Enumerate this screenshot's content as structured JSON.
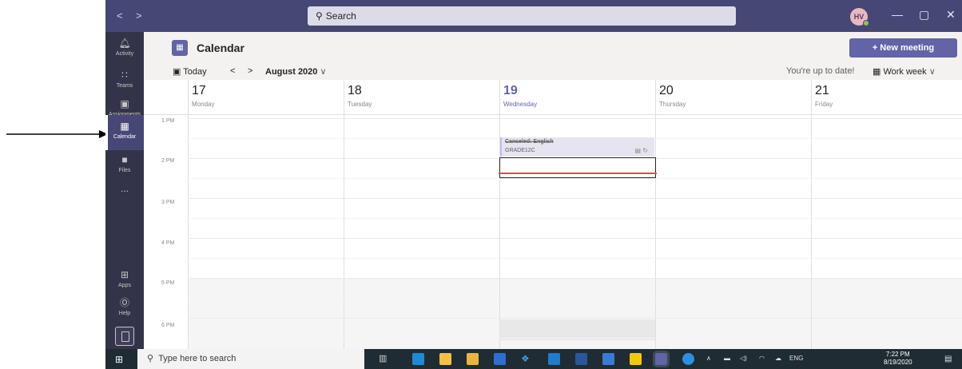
{
  "window": {
    "nav_back": "<",
    "nav_forward": ">",
    "search_placeholder": "Search",
    "avatar_initials": "HV",
    "minimize": "—",
    "maximize": "▢",
    "close": "✕"
  },
  "rail": {
    "items": [
      {
        "label": "Activity",
        "icon": "bell-icon"
      },
      {
        "label": "Teams",
        "icon": "teams-icon"
      },
      {
        "label": "Assignments",
        "icon": "assignments-icon"
      },
      {
        "label": "Calendar",
        "icon": "calendar-icon"
      },
      {
        "label": "Files",
        "icon": "files-icon"
      },
      {
        "label": "...",
        "icon": "more-icon"
      },
      {
        "label": "Apps",
        "icon": "apps-icon"
      },
      {
        "label": "Help",
        "icon": "help-icon"
      }
    ]
  },
  "header": {
    "title": "Calendar",
    "new_meeting": "+ New meeting"
  },
  "toolbar": {
    "today": "Today",
    "prev": "<",
    "next": ">",
    "month": "August 2020",
    "status": "You're up to date!",
    "view": "Work week"
  },
  "days": [
    {
      "num": "17",
      "name": "Monday"
    },
    {
      "num": "18",
      "name": "Tuesday"
    },
    {
      "num": "19",
      "name": "Wednesday"
    },
    {
      "num": "20",
      "name": "Thursday"
    },
    {
      "num": "21",
      "name": "Friday"
    }
  ],
  "hours": [
    "1 PM",
    "2 PM",
    "3 PM",
    "4 PM",
    "5 PM",
    "6 PM"
  ],
  "event": {
    "title": "Canceled: English",
    "channel": "GRADE12C"
  },
  "taskbar": {
    "search_placeholder": "Type here to search",
    "lang": "ENG",
    "time": "7:22 PM",
    "date": "8/19/2020"
  },
  "colors": {
    "accent": "#6264a7",
    "titlebar": "#464775",
    "rail": "#33344a",
    "now_line": "#e74c3c"
  }
}
